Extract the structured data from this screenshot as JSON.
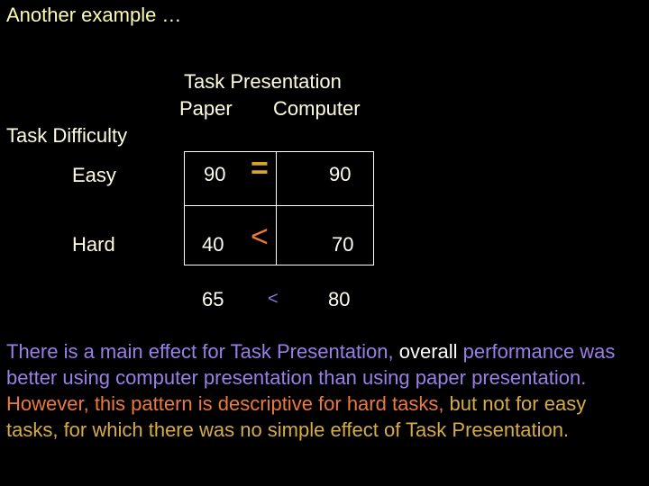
{
  "slide": {
    "title": "Another example …"
  },
  "table": {
    "column_factor": "Task Presentation",
    "columns": [
      "Paper",
      "Computer"
    ],
    "row_factor": "Task Difficulty",
    "rows": [
      {
        "label": "Easy",
        "values": [
          "90",
          "90"
        ],
        "comparison": "="
      },
      {
        "label": "Hard",
        "values": [
          "40",
          "70"
        ],
        "comparison": "<"
      }
    ],
    "marginal_means": [
      "65",
      "80"
    ],
    "marginal_comparison": "<"
  },
  "colors": {
    "title": "#fffbb0",
    "main_effect_text": "#9b7fe8",
    "simple_effect_hard": "#ec7a3c",
    "simple_effect_easy": "#d6ac45",
    "equal_sign": "#d8a52a"
  },
  "paragraph": {
    "seg1": "There is a main effect for Task Presentation, ",
    "seg2": "overall",
    "seg3": " performance was better using computer presentation than using paper presentation.  ",
    "seg4": "However, this pattern is descriptive for hard tasks, ",
    "seg5": "but not for easy tasks, for which there was no simple effect of Task Presentation."
  }
}
